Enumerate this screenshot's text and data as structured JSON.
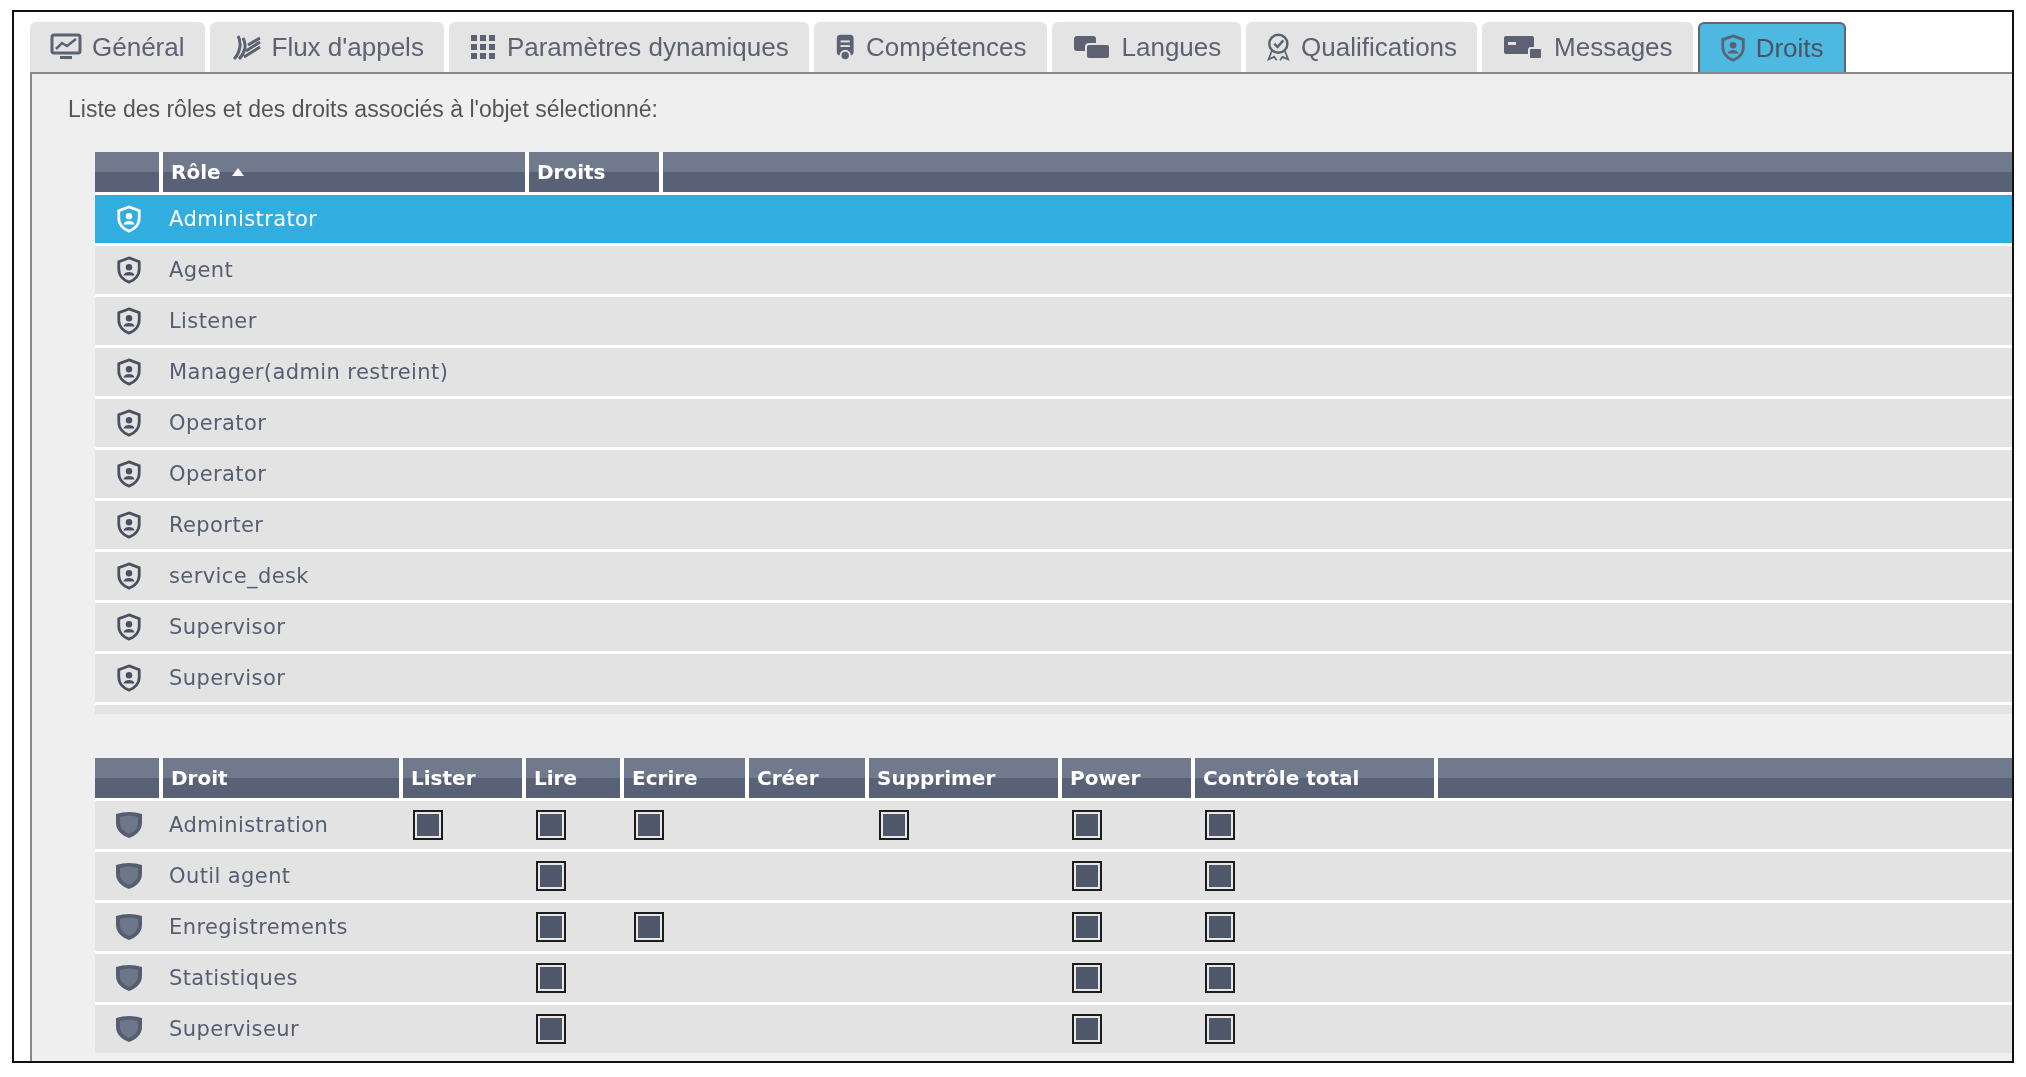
{
  "tabs": [
    {
      "label": "Général",
      "selected": false
    },
    {
      "label": "Flux d'appels",
      "selected": false
    },
    {
      "label": "Paramètres dynamiques",
      "selected": false
    },
    {
      "label": "Compétences",
      "selected": false
    },
    {
      "label": "Langues",
      "selected": false
    },
    {
      "label": "Qualifications",
      "selected": false
    },
    {
      "label": "Messages",
      "selected": false
    },
    {
      "label": "Droits",
      "selected": true
    }
  ],
  "intro": "Liste des rôles et des droits associés à l'objet sélectionné:",
  "roles_table": {
    "columns": [
      {
        "label": "Rôle",
        "sorted": true
      },
      {
        "label": "Droits",
        "sorted": false
      }
    ],
    "rows": [
      {
        "name": "Administrator",
        "selected": true
      },
      {
        "name": "Agent",
        "selected": false
      },
      {
        "name": "Listener",
        "selected": false
      },
      {
        "name": "Manager(admin restreint)",
        "selected": false
      },
      {
        "name": "Operator",
        "selected": false
      },
      {
        "name": "Operator",
        "selected": false
      },
      {
        "name": "Reporter",
        "selected": false
      },
      {
        "name": "service_desk",
        "selected": false
      },
      {
        "name": "Supervisor",
        "selected": false
      },
      {
        "name": "Supervisor",
        "selected": false
      }
    ]
  },
  "rights_table": {
    "columns": [
      "Droit",
      "Lister",
      "Lire",
      "Ecrire",
      "Créer",
      "Supprimer",
      "Power",
      "Contrôle total"
    ],
    "rows": [
      {
        "name": "Administration",
        "checked": [
          true,
          true,
          true,
          false,
          true,
          true,
          true
        ]
      },
      {
        "name": "Outil agent",
        "checked": [
          false,
          true,
          false,
          false,
          false,
          true,
          true
        ]
      },
      {
        "name": "Enregistrements",
        "checked": [
          false,
          true,
          true,
          false,
          false,
          true,
          true
        ]
      },
      {
        "name": "Statistiques",
        "checked": [
          false,
          true,
          false,
          false,
          false,
          true,
          true
        ]
      },
      {
        "name": "Superviseur",
        "checked": [
          false,
          true,
          false,
          false,
          false,
          true,
          true
        ]
      }
    ]
  }
}
